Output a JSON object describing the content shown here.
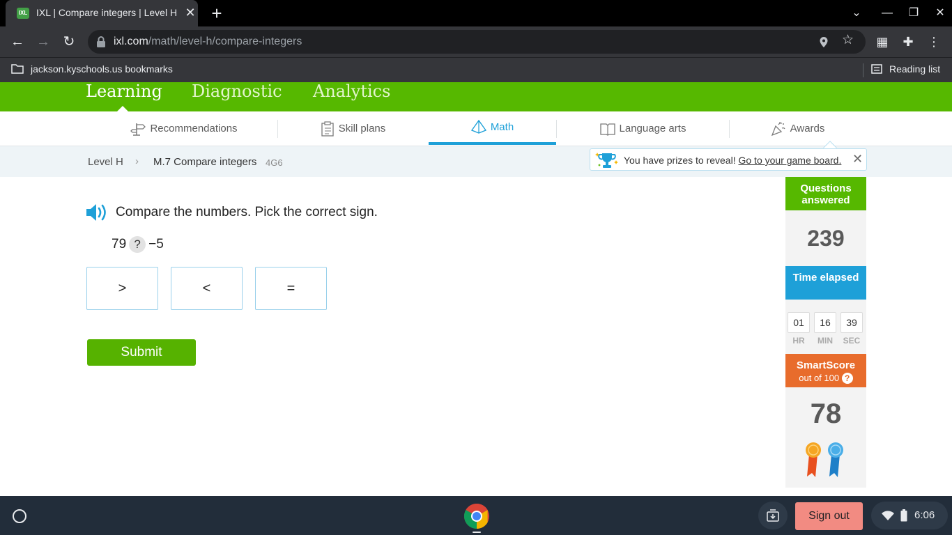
{
  "browser": {
    "tab_title": "IXL | Compare integers | Level H math",
    "tab_favicon": "IXL",
    "url_host": "ixl.com",
    "url_path": "/math/level-h/compare-integers",
    "bookmark_folder": "jackson.kyschools.us bookmarks",
    "reading_list": "Reading list"
  },
  "main_nav": {
    "learning": "Learning",
    "diagnostic": "Diagnostic",
    "analytics": "Analytics"
  },
  "sub_nav": [
    {
      "label": "Recommendations",
      "icon": "signpost-icon"
    },
    {
      "label": "Skill plans",
      "icon": "clipboard-icon"
    },
    {
      "label": "Math",
      "icon": "pyramid-icon",
      "active": true
    },
    {
      "label": "Language arts",
      "icon": "book-icon"
    },
    {
      "label": "Awards",
      "icon": "party-popper-icon"
    }
  ],
  "breadcrumb": {
    "level": "Level H",
    "skill": "M.7 Compare integers",
    "code": "4G6"
  },
  "prize_banner": {
    "text": "You have prizes to reveal!",
    "link": "Go to your game board."
  },
  "question": {
    "prompt": "Compare the numbers. Pick the correct sign.",
    "left": "79",
    "placeholder": "?",
    "right": "−5",
    "choices": [
      ">",
      "<",
      "="
    ],
    "submit": "Submit"
  },
  "sidebar": {
    "questions_label": "Questions answered",
    "questions_value": "239",
    "time_label": "Time elapsed",
    "time_hr": "01",
    "time_min": "16",
    "time_sec": "39",
    "hr_label": "HR",
    "min_label": "MIN",
    "sec_label": "SEC",
    "smartscore_label": "SmartScore",
    "smartscore_sub": "out of 100",
    "help": "?",
    "smartscore_value": "78"
  },
  "taskbar": {
    "sign_out": "Sign out",
    "time": "6:06"
  },
  "colors": {
    "ixl_green": "#56b800",
    "math_blue": "#1ea0d8",
    "questions_green": "#56b800",
    "time_blue": "#1ea0d8",
    "smartscore_orange": "#e86c2c",
    "sign_out": "#f28b82"
  }
}
